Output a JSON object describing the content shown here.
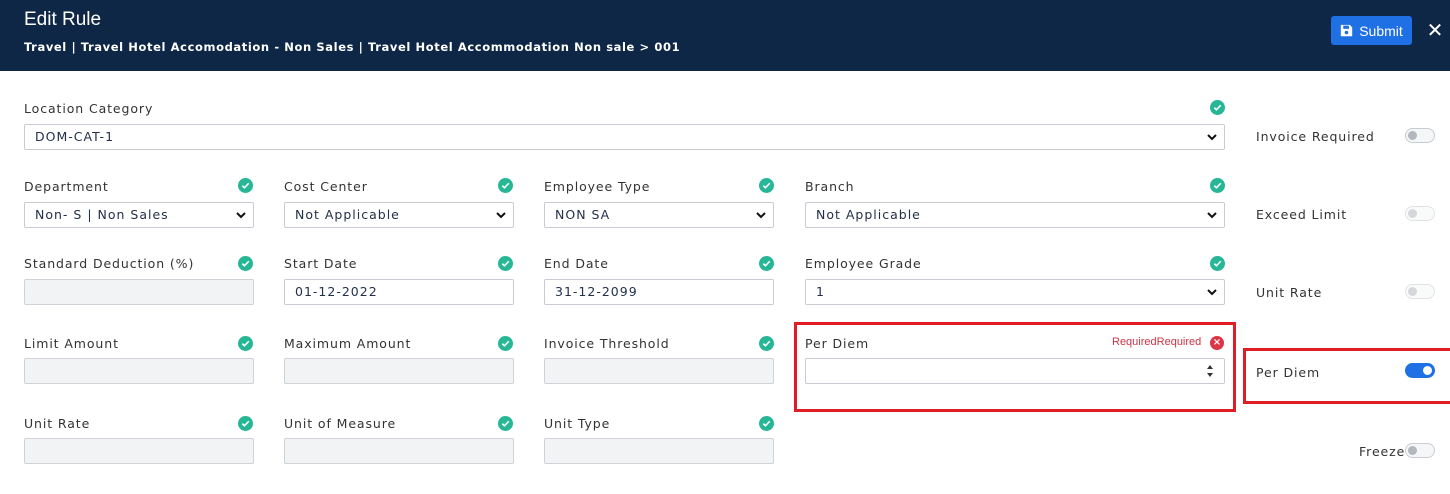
{
  "header": {
    "title": "Edit Rule",
    "breadcrumb": "Travel | Travel Hotel Accomodation - Non Sales | Travel Hotel Accommodation Non sale > 001",
    "submit_label": "Submit",
    "close_glyph": "✕",
    "accent_color": "#1f6fe5",
    "background_color": "#0f2746"
  },
  "form": {
    "location_category": {
      "label": "Location Category",
      "value": "DOM-CAT-1"
    },
    "department": {
      "label": "Department",
      "value": "Non- S | Non Sales"
    },
    "cost_center": {
      "label": "Cost Center",
      "value": "Not Applicable"
    },
    "employee_type": {
      "label": "Employee Type",
      "value": "NON SA"
    },
    "branch": {
      "label": "Branch",
      "value": "Not Applicable"
    },
    "standard_deduction": {
      "label": "Standard Deduction (%)",
      "value": ""
    },
    "start_date": {
      "label": "Start Date",
      "value": "01-12-2022"
    },
    "end_date": {
      "label": "End Date",
      "value": "31-12-2099"
    },
    "employee_grade": {
      "label": "Employee Grade",
      "value": "1"
    },
    "limit_amount": {
      "label": "Limit Amount",
      "value": ""
    },
    "maximum_amount": {
      "label": "Maximum Amount",
      "value": ""
    },
    "invoice_threshold": {
      "label": "Invoice Threshold",
      "value": ""
    },
    "per_diem": {
      "label": "Per Diem",
      "value": "",
      "error": "RequiredRequired"
    },
    "unit_rate": {
      "label": "Unit Rate",
      "value": ""
    },
    "unit_of_measure": {
      "label": "Unit of Measure",
      "value": ""
    },
    "unit_type": {
      "label": "Unit Type",
      "value": ""
    }
  },
  "side": {
    "invoice_required": {
      "label": "Invoice Required",
      "on": false
    },
    "exceed_limit": {
      "label": "Exceed Limit",
      "on": false
    },
    "unit_rate": {
      "label": "Unit Rate",
      "on": false
    },
    "per_diem": {
      "label": "Per Diem",
      "on": true
    },
    "freeze": {
      "label": "Freeze",
      "on": false
    }
  },
  "colors": {
    "valid": "#27b797",
    "error": "#dc3545",
    "highlight": "#e01c24"
  },
  "icons": [
    "save-icon",
    "close-icon",
    "check-circle-icon",
    "chevron-down-icon",
    "spinner-arrows-icon",
    "error-x-icon"
  ]
}
